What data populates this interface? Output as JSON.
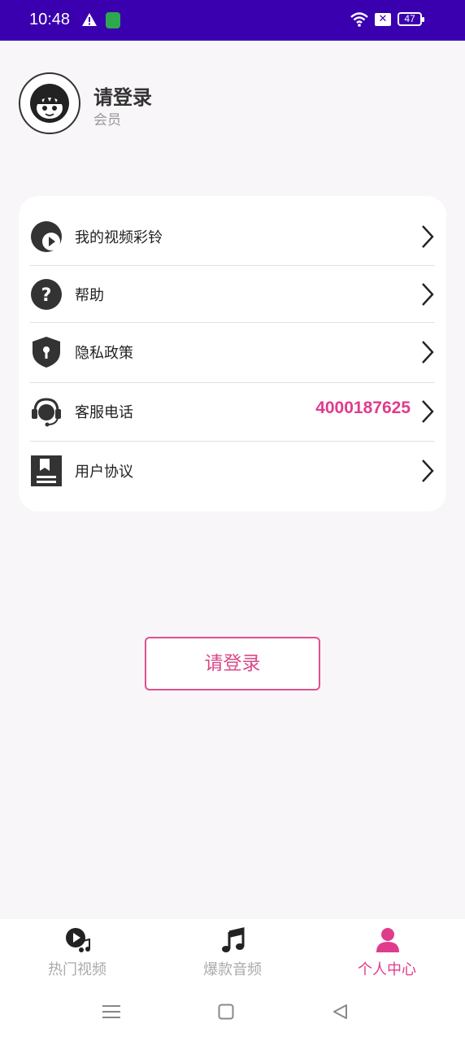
{
  "status_bar": {
    "time": "10:48",
    "battery": "47"
  },
  "profile": {
    "name": "请登录",
    "subtitle": "会员"
  },
  "menu": {
    "items": [
      {
        "label": "我的视频彩铃",
        "icon": "video-ringtone-icon"
      },
      {
        "label": "帮助",
        "icon": "help-icon"
      },
      {
        "label": "隐私政策",
        "icon": "privacy-shield-icon"
      },
      {
        "label": "客服电话",
        "value": "4000187625",
        "icon": "customer-service-icon"
      },
      {
        "label": "用户协议",
        "icon": "user-agreement-icon"
      }
    ]
  },
  "login_button": "请登录",
  "tabs": [
    {
      "label": "热门视频",
      "icon": "hot-video-icon"
    },
    {
      "label": "爆款音频",
      "icon": "music-note-icon"
    },
    {
      "label": "个人中心",
      "icon": "person-icon",
      "active": true
    }
  ],
  "colors": {
    "accent": "#e03c8c",
    "status_bar": "#3a00b0"
  }
}
